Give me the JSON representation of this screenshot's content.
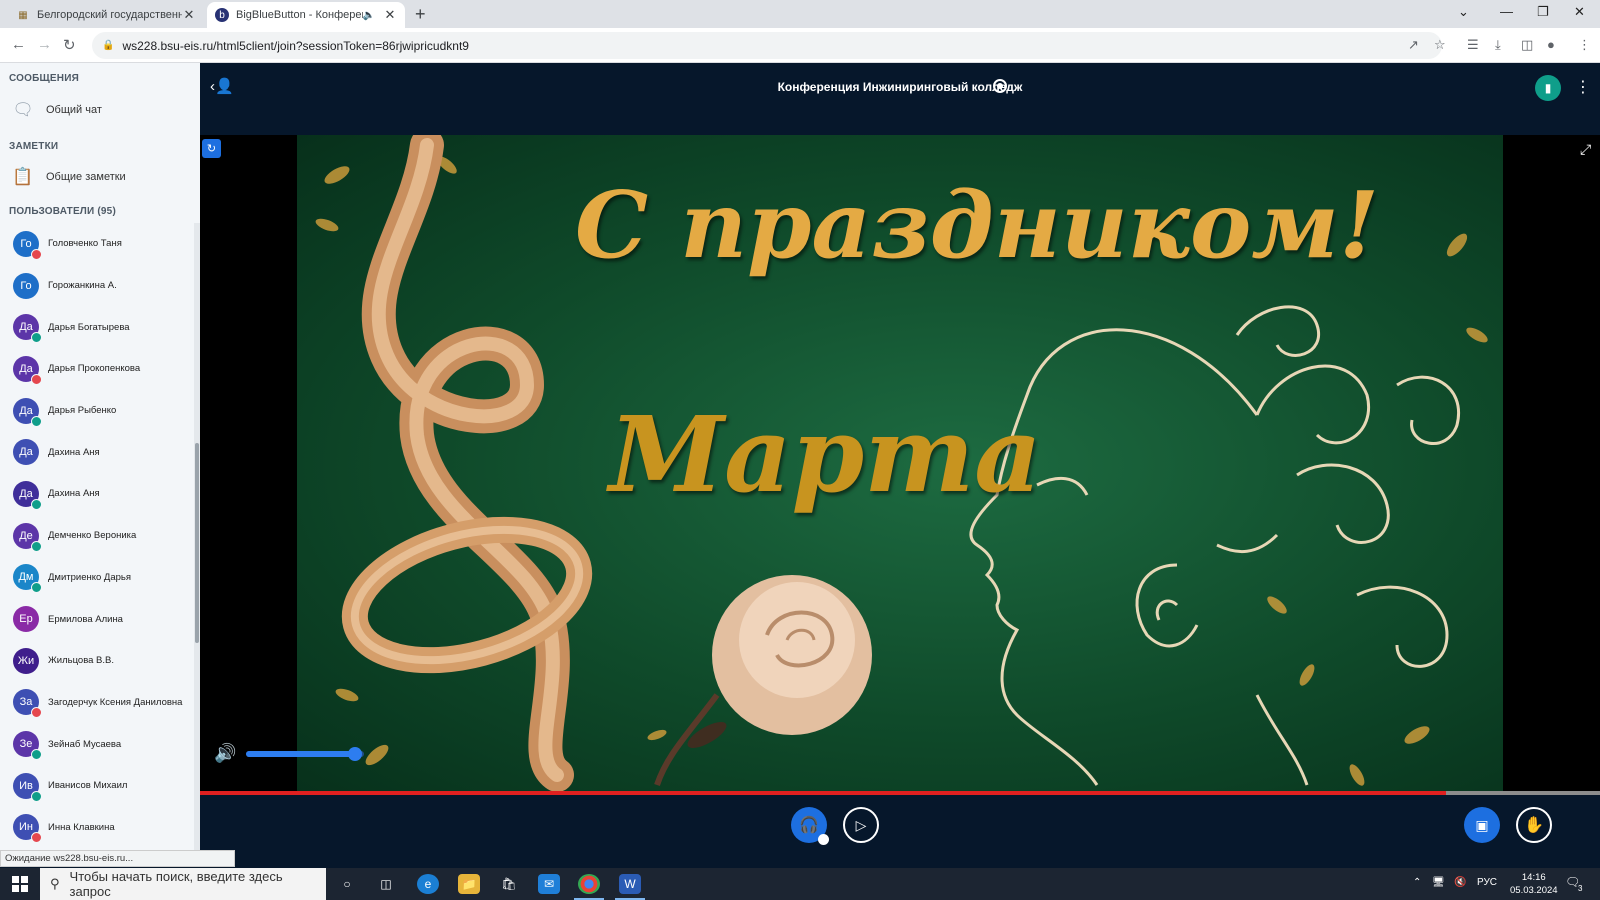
{
  "browser": {
    "tabs": [
      {
        "title": "Белгородский государственный",
        "active": false
      },
      {
        "title": "BigBlueButton - Конференция",
        "active": true
      }
    ],
    "url": "ws228.bsu-eis.ru/html5client/join?sessionToken=86rjwipricudknt9"
  },
  "sidebar": {
    "messages_title": "СООБЩЕНИЯ",
    "public_chat": "Общий чат",
    "notes_title": "ЗАМЕТКИ",
    "shared_notes": "Общие заметки",
    "users_title": "ПОЛЬЗОВАТЕЛИ (95)",
    "users": [
      {
        "initials": "Го",
        "name": "Головченко Таня",
        "color": "#1e6fc8",
        "status": "muted"
      },
      {
        "initials": "Го",
        "name": "Горожанкина А.",
        "color": "#1e6fc8",
        "status": "none"
      },
      {
        "initials": "Да",
        "name": "Дарья Богатырева",
        "color": "#5c35a8",
        "status": "mic-on"
      },
      {
        "initials": "Да",
        "name": "Дарья Прокопенкова",
        "color": "#5c35a8",
        "status": "muted"
      },
      {
        "initials": "Да",
        "name": "Дарья Рыбенко",
        "color": "#3e4fb3",
        "status": "mic-on"
      },
      {
        "initials": "Да",
        "name": "Дахина Аня",
        "color": "#3e4fb3",
        "status": "none"
      },
      {
        "initials": "Да",
        "name": "Дахина Аня",
        "color": "#3f2e9a",
        "status": "mic-on"
      },
      {
        "initials": "Де",
        "name": "Демченко Вероника",
        "color": "#5c35a8",
        "status": "mic-on"
      },
      {
        "initials": "Дм",
        "name": "Дмитриенко Дарья",
        "color": "#1a86c9",
        "status": "mic-on"
      },
      {
        "initials": "Ер",
        "name": "Ермилова Алина",
        "color": "#8a2aa6",
        "status": "none"
      },
      {
        "initials": "Жи",
        "name": "Жильцова В.В.",
        "color": "#3f1e8c",
        "status": "none"
      },
      {
        "initials": "За",
        "name": "Загодерчук Ксения Даниловна",
        "color": "#3e4fb3",
        "status": "muted"
      },
      {
        "initials": "Зе",
        "name": "Зейнаб Мусаева",
        "color": "#5c35a8",
        "status": "mic-on"
      },
      {
        "initials": "Ив",
        "name": "Иванисов Михаил",
        "color": "#3e4fb3",
        "status": "mic-on"
      },
      {
        "initials": "Ин",
        "name": "Инна Клавкина",
        "color": "#3e4fb3",
        "status": "muted"
      }
    ]
  },
  "status_text": "Ожидание ws228.bsu-eis.ru...",
  "main": {
    "meeting_title": "Конференция Инжиниринговый колледж",
    "slide_line1": "С праздником!",
    "slide_line2": "Марта",
    "volume_level": 0.92,
    "video_progress": 0.89
  },
  "taskbar": {
    "search_placeholder": "Чтобы начать поиск, введите здесь запрос",
    "lang": "РУС",
    "time": "14:16",
    "date": "05.03.2024",
    "notifications": "3"
  },
  "colors": {
    "accent": "#1d6fe0",
    "dark_bg": "#06172b",
    "mic_on": "#0f9e8a",
    "muted": "#e5474e"
  }
}
